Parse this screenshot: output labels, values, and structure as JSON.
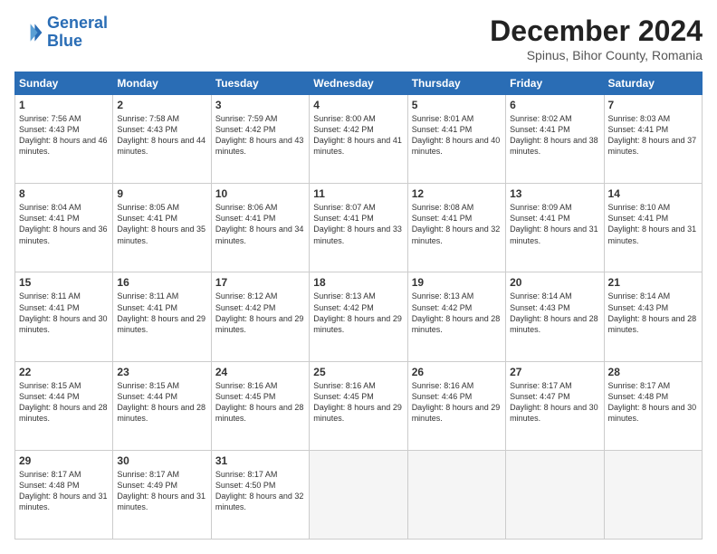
{
  "logo": {
    "line1": "General",
    "line2": "Blue"
  },
  "header": {
    "month": "December 2024",
    "location": "Spinus, Bihor County, Romania"
  },
  "days": [
    "Sunday",
    "Monday",
    "Tuesday",
    "Wednesday",
    "Thursday",
    "Friday",
    "Saturday"
  ],
  "weeks": [
    [
      {
        "day": "1",
        "rise": "7:56 AM",
        "set": "4:43 PM",
        "daylight": "8 hours and 46 minutes."
      },
      {
        "day": "2",
        "rise": "7:58 AM",
        "set": "4:43 PM",
        "daylight": "8 hours and 44 minutes."
      },
      {
        "day": "3",
        "rise": "7:59 AM",
        "set": "4:42 PM",
        "daylight": "8 hours and 43 minutes."
      },
      {
        "day": "4",
        "rise": "8:00 AM",
        "set": "4:42 PM",
        "daylight": "8 hours and 41 minutes."
      },
      {
        "day": "5",
        "rise": "8:01 AM",
        "set": "4:41 PM",
        "daylight": "8 hours and 40 minutes."
      },
      {
        "day": "6",
        "rise": "8:02 AM",
        "set": "4:41 PM",
        "daylight": "8 hours and 38 minutes."
      },
      {
        "day": "7",
        "rise": "8:03 AM",
        "set": "4:41 PM",
        "daylight": "8 hours and 37 minutes."
      }
    ],
    [
      {
        "day": "8",
        "rise": "8:04 AM",
        "set": "4:41 PM",
        "daylight": "8 hours and 36 minutes."
      },
      {
        "day": "9",
        "rise": "8:05 AM",
        "set": "4:41 PM",
        "daylight": "8 hours and 35 minutes."
      },
      {
        "day": "10",
        "rise": "8:06 AM",
        "set": "4:41 PM",
        "daylight": "8 hours and 34 minutes."
      },
      {
        "day": "11",
        "rise": "8:07 AM",
        "set": "4:41 PM",
        "daylight": "8 hours and 33 minutes."
      },
      {
        "day": "12",
        "rise": "8:08 AM",
        "set": "4:41 PM",
        "daylight": "8 hours and 32 minutes."
      },
      {
        "day": "13",
        "rise": "8:09 AM",
        "set": "4:41 PM",
        "daylight": "8 hours and 31 minutes."
      },
      {
        "day": "14",
        "rise": "8:10 AM",
        "set": "4:41 PM",
        "daylight": "8 hours and 31 minutes."
      }
    ],
    [
      {
        "day": "15",
        "rise": "8:11 AM",
        "set": "4:41 PM",
        "daylight": "8 hours and 30 minutes."
      },
      {
        "day": "16",
        "rise": "8:11 AM",
        "set": "4:41 PM",
        "daylight": "8 hours and 29 minutes."
      },
      {
        "day": "17",
        "rise": "8:12 AM",
        "set": "4:42 PM",
        "daylight": "8 hours and 29 minutes."
      },
      {
        "day": "18",
        "rise": "8:13 AM",
        "set": "4:42 PM",
        "daylight": "8 hours and 29 minutes."
      },
      {
        "day": "19",
        "rise": "8:13 AM",
        "set": "4:42 PM",
        "daylight": "8 hours and 28 minutes."
      },
      {
        "day": "20",
        "rise": "8:14 AM",
        "set": "4:43 PM",
        "daylight": "8 hours and 28 minutes."
      },
      {
        "day": "21",
        "rise": "8:14 AM",
        "set": "4:43 PM",
        "daylight": "8 hours and 28 minutes."
      }
    ],
    [
      {
        "day": "22",
        "rise": "8:15 AM",
        "set": "4:44 PM",
        "daylight": "8 hours and 28 minutes."
      },
      {
        "day": "23",
        "rise": "8:15 AM",
        "set": "4:44 PM",
        "daylight": "8 hours and 28 minutes."
      },
      {
        "day": "24",
        "rise": "8:16 AM",
        "set": "4:45 PM",
        "daylight": "8 hours and 28 minutes."
      },
      {
        "day": "25",
        "rise": "8:16 AM",
        "set": "4:45 PM",
        "daylight": "8 hours and 29 minutes."
      },
      {
        "day": "26",
        "rise": "8:16 AM",
        "set": "4:46 PM",
        "daylight": "8 hours and 29 minutes."
      },
      {
        "day": "27",
        "rise": "8:17 AM",
        "set": "4:47 PM",
        "daylight": "8 hours and 30 minutes."
      },
      {
        "day": "28",
        "rise": "8:17 AM",
        "set": "4:48 PM",
        "daylight": "8 hours and 30 minutes."
      }
    ],
    [
      {
        "day": "29",
        "rise": "8:17 AM",
        "set": "4:48 PM",
        "daylight": "8 hours and 31 minutes."
      },
      {
        "day": "30",
        "rise": "8:17 AM",
        "set": "4:49 PM",
        "daylight": "8 hours and 31 minutes."
      },
      {
        "day": "31",
        "rise": "8:17 AM",
        "set": "4:50 PM",
        "daylight": "8 hours and 32 minutes."
      },
      null,
      null,
      null,
      null
    ]
  ]
}
